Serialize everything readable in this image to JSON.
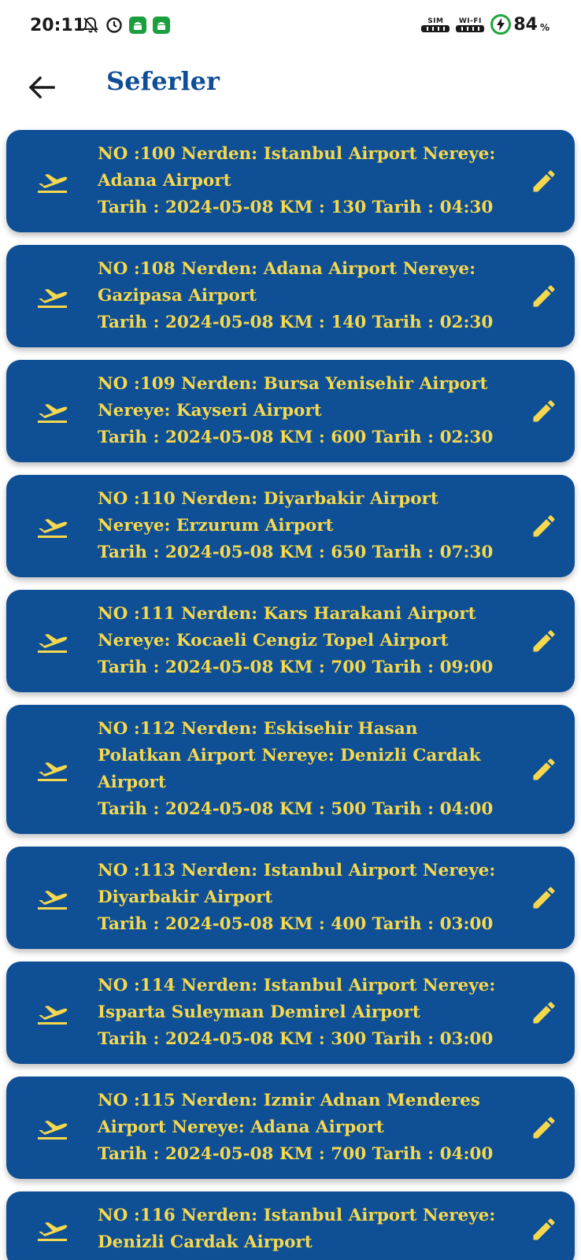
{
  "status_bar": {
    "time": "20:11",
    "sim_label": "SIM",
    "wifi_label": "WI-FI",
    "battery_percent": "84",
    "battery_sign": "%"
  },
  "app_bar": {
    "title": "Seferler",
    "back_icon": "arrow-back-icon"
  },
  "flights": [
    {
      "line1": "NO :100 Nerden: Istanbul Airport Nereye: Adana Airport",
      "line2": "Tarih : 2024-05-08 KM : 130 Tarih : 04:30"
    },
    {
      "line1": "NO :108 Nerden: Adana Airport Nereye: Gazipasa Airport",
      "line2": "Tarih : 2024-05-08 KM : 140 Tarih : 02:30"
    },
    {
      "line1": "NO :109 Nerden: Bursa Yenisehir Airport Nereye: Kayseri Airport",
      "line2": "Tarih : 2024-05-08 KM : 600 Tarih : 02:30"
    },
    {
      "line1": "NO :110 Nerden: Diyarbakir Airport Nereye: Erzurum Airport",
      "line2": "Tarih : 2024-05-08 KM : 650 Tarih : 07:30"
    },
    {
      "line1": "NO :111 Nerden: Kars Harakani Airport Nereye: Kocaeli Cengiz Topel Airport",
      "line2": "Tarih : 2024-05-08 KM : 700 Tarih : 09:00"
    },
    {
      "line1": "NO :112 Nerden: Eskisehir Hasan Polatkan Airport Nereye: Denizli Cardak Airport",
      "line2": "Tarih : 2024-05-08 KM : 500 Tarih : 04:00"
    },
    {
      "line1": "NO :113 Nerden: Istanbul Airport Nereye: Diyarbakir Airport",
      "line2": "Tarih : 2024-05-08 KM : 400 Tarih : 03:00"
    },
    {
      "line1": "NO :114 Nerden: Istanbul Airport Nereye: Isparta Suleyman Demirel Airport",
      "line2": "Tarih : 2024-05-08 KM : 300 Tarih : 03:00"
    },
    {
      "line1": "NO :115 Nerden: Izmir Adnan Menderes Airport Nereye: Adana Airport",
      "line2": "Tarih : 2024-05-08 KM : 700 Tarih : 04:00"
    },
    {
      "line1": "NO :116 Nerden: Istanbul Airport Nereye: Denizli Cardak Airport",
      "line2": ""
    }
  ],
  "colors": {
    "card_bg": "#0e4f95",
    "card_text": "#f5d84e",
    "title": "#0f4e96"
  },
  "icons": {
    "leading": "flight-takeoff-icon",
    "trailing": "edit-pencil-icon"
  }
}
